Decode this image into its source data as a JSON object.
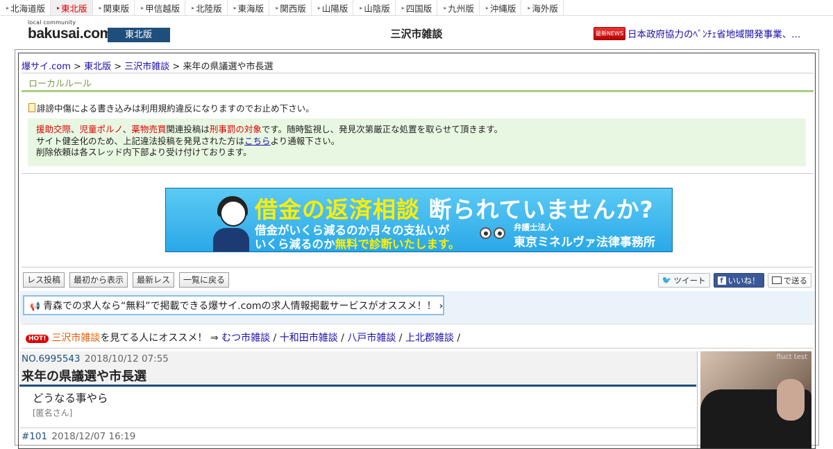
{
  "regions": [
    "北海道版",
    "東北版",
    "関東版",
    "甲信越版",
    "北陸版",
    "東海版",
    "関西版",
    "山陽版",
    "山陰版",
    "四国版",
    "九州版",
    "沖縄版",
    "海外版"
  ],
  "header": {
    "logo_small": "local community",
    "logo_main": "bakusai.com",
    "edition": "東北版",
    "title": "三沢市雑談",
    "news_badge": "最新NEWS",
    "news_text": "日本政府協力のﾍﾞﾝﾁｪ省地域開発事業、..."
  },
  "breadcrumb": {
    "home": "爆サイ.com",
    "edition": "東北版",
    "board": "三沢市雑談",
    "sep": " > ",
    "current": "来年の県議選や市長選"
  },
  "local_rule": "ローカルルール",
  "notice1": "誹謗中傷による書き込みは利用規約違反になりますのでお止め下さい。",
  "warn": {
    "w1": "援助交際",
    "c1": "、",
    "w2": "児童ポルノ",
    "c2": "、",
    "w3": "薬物売買",
    "t1": "関連投稿は",
    "w4": "刑事罰の対象",
    "t2": "です。随時監視し、発見次第厳正な処置を取らせて頂きます。",
    "t3": "サイト健全化のため、上記違法投稿を発見された方は",
    "link": "こちら",
    "t4": "より通報下さい。",
    "t5": "削除依頼は各スレッド内下部より受け付けております。"
  },
  "banner": {
    "h1_yellow": "借金の返済相談",
    "h1_white": "断られていませんか?",
    "line1": "借金がいくら減るのか月々の支払いが",
    "line2a": "いくら減るのか",
    "line2b": "無料で診断いたします。",
    "firm_sub": "弁護士法人",
    "firm": "東京ミネルヴァ法律事務所"
  },
  "buttons": {
    "post": "レス投稿",
    "from_start": "最初から表示",
    "latest": "最新レス",
    "back": "一覧に戻る"
  },
  "social": {
    "tweet": "ツイート",
    "like": "いいね！",
    "send": "で送る"
  },
  "promo": "青森での求人なら“無料”で掲載できる爆サイ.comの求人情報掲載サービスがオススメ！！",
  "hot": {
    "badge": "HOT!",
    "board": "三沢市雑談",
    "text": "を見てる人にオススメ！ ⇒",
    "links": [
      "むつ市雑談",
      "十和田市雑談",
      "八戸市雑談",
      "上北郡雑談"
    ],
    "sep": "/"
  },
  "post": {
    "no": "NO.6995543",
    "date": "2018/10/12 07:55",
    "title": "来年の県議選や市長選",
    "body": "どうなる事やら",
    "author": "[匿名さん]"
  },
  "reply": {
    "no": "#101",
    "date": "2018/12/07 16:19"
  },
  "ad_label": "fluct test"
}
